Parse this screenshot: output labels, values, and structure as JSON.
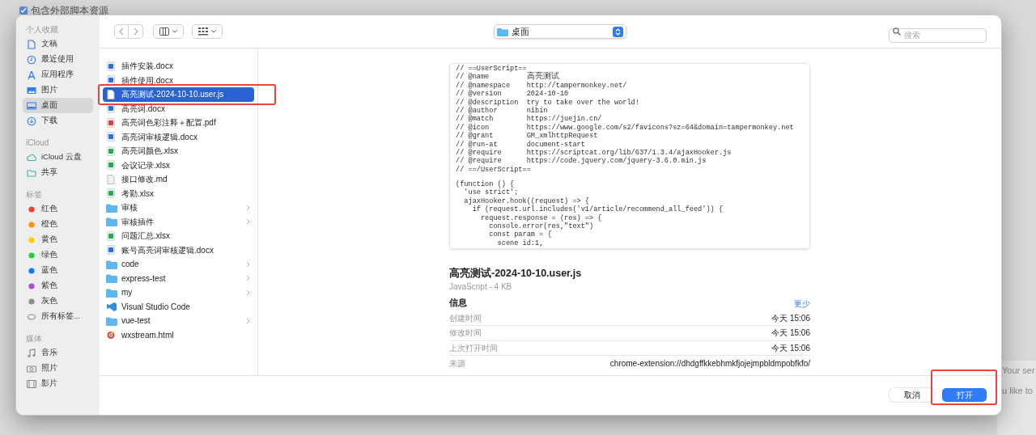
{
  "background": {
    "checkbox": {
      "label": "包含外部脚本资源",
      "checked": true
    },
    "side_texts": [
      "Your ser",
      "u like to"
    ]
  },
  "toolbar": {
    "location": "桌面",
    "search": {
      "placeholder": "搜索"
    }
  },
  "sidebar": {
    "sections": [
      {
        "title": "个人收藏",
        "items": [
          {
            "label": "文稿",
            "selected": false
          },
          {
            "label": "最近使用",
            "selected": false
          },
          {
            "label": "应用程序",
            "selected": false
          },
          {
            "label": "图片",
            "selected": false
          },
          {
            "label": "桌面",
            "selected": true
          },
          {
            "label": "下载",
            "selected": false
          }
        ]
      },
      {
        "title": "iCloud",
        "items": [
          {
            "label": "iCloud 云盘",
            "selected": false
          },
          {
            "label": "共享",
            "selected": false
          }
        ]
      },
      {
        "title": "标签",
        "items": [
          {
            "label": "红色",
            "color": "#fe3b30",
            "selected": false
          },
          {
            "label": "橙色",
            "color": "#fe9500",
            "selected": false
          },
          {
            "label": "黄色",
            "color": "#fecc00",
            "selected": false
          },
          {
            "label": "绿色",
            "color": "#28c840",
            "selected": false
          },
          {
            "label": "蓝色",
            "color": "#0a7aff",
            "selected": false
          },
          {
            "label": "紫色",
            "color": "#a550d7",
            "selected": false
          },
          {
            "label": "灰色",
            "color": "#8e8e93",
            "selected": false
          },
          {
            "label": "所有标签...",
            "selected": false
          }
        ]
      },
      {
        "title": "媒体",
        "items": [
          {
            "label": "音乐",
            "selected": false
          },
          {
            "label": "照片",
            "selected": false
          },
          {
            "label": "影片",
            "selected": false
          }
        ]
      }
    ]
  },
  "files": [
    {
      "name": "插件安装.docx",
      "kind": "word",
      "selected": false
    },
    {
      "name": "插件使用.docx",
      "kind": "word",
      "selected": false
    },
    {
      "name": "高亮测试-2024-10-10.user.js",
      "kind": "script",
      "selected": true
    },
    {
      "name": "高亮词.docx",
      "kind": "word",
      "selected": false
    },
    {
      "name": "高亮词色彩注释＋配置.pdf",
      "kind": "pdf",
      "selected": false
    },
    {
      "name": "高亮词审核逻辑.docx",
      "kind": "word",
      "selected": false
    },
    {
      "name": "高亮词颜色.xlsx",
      "kind": "sheet",
      "selected": false
    },
    {
      "name": "会议记录.xlsx",
      "kind": "sheet",
      "selected": false
    },
    {
      "name": "接口修改.md",
      "kind": "text",
      "selected": false
    },
    {
      "name": "考勤.xlsx",
      "kind": "sheet",
      "selected": false
    },
    {
      "name": "审核",
      "kind": "folder",
      "selected": false
    },
    {
      "name": "审核插件",
      "kind": "folder",
      "selected": false
    },
    {
      "name": "问题汇总.xlsx",
      "kind": "sheet",
      "selected": false
    },
    {
      "name": "账号高亮词审核逻辑.docx",
      "kind": "word",
      "selected": false
    },
    {
      "name": "code",
      "kind": "folder",
      "selected": false
    },
    {
      "name": "express-test",
      "kind": "folder",
      "selected": false
    },
    {
      "name": "my",
      "kind": "folder",
      "selected": false
    },
    {
      "name": "Visual Studio Code",
      "kind": "app",
      "selected": false
    },
    {
      "name": "vue-test",
      "kind": "folder",
      "selected": false
    },
    {
      "name": "wxstream.html",
      "kind": "web",
      "selected": false
    }
  ],
  "preview": {
    "code_header": [
      "// ==UserScript==",
      "// @name         高亮测试",
      "// @namespace    http://tampermonkey.net/",
      "// @version      2024-10-10",
      "// @description  try to take over the world!",
      "// @author       nibin",
      "// @match        https://juejin.cn/",
      "// @icon         https://www.google.com/s2/favicons?sz=64&domain=tampermonkey.net",
      "// @grant        GM_xmlhttpRequest",
      "// @run-at       document-start",
      "// @require      https://scriptcat.org/lib/637/1.3.4/ajaxHooker.js",
      "// @require      https://code.jquery.com/jquery-3.6.0.min.js",
      "// ==/UserScript=="
    ],
    "code_body": [
      "(function () {",
      "  'use strict';",
      "  ajaxHooker.hook((request) => {",
      "    if (request.url.includes('v1/article/recommend_all_feed')) {",
      "      request.response = (res) => {",
      "        console.error(res,\"text\")",
      "        const param = {",
      "          scene id:1,"
    ],
    "file_name": "高亮测试-2024-10-10.user.js",
    "file_type": "JavaScript - 4 KB",
    "info_title": "信息",
    "info_toggle": "更少",
    "info_rows": [
      {
        "label": "创建时间",
        "value": "今天 15:06"
      },
      {
        "label": "修改时间",
        "value": "今天 15:06"
      },
      {
        "label": "上次打开时间",
        "value": "今天 15:06"
      },
      {
        "label": "来源",
        "value": "chrome-extension://dhdgffkkebhmkfjojejmpbldmpobfkfo/"
      }
    ]
  },
  "buttons": [
    {
      "label": "取消",
      "kind": "secondary"
    },
    {
      "label": "打开",
      "kind": "primary"
    }
  ]
}
